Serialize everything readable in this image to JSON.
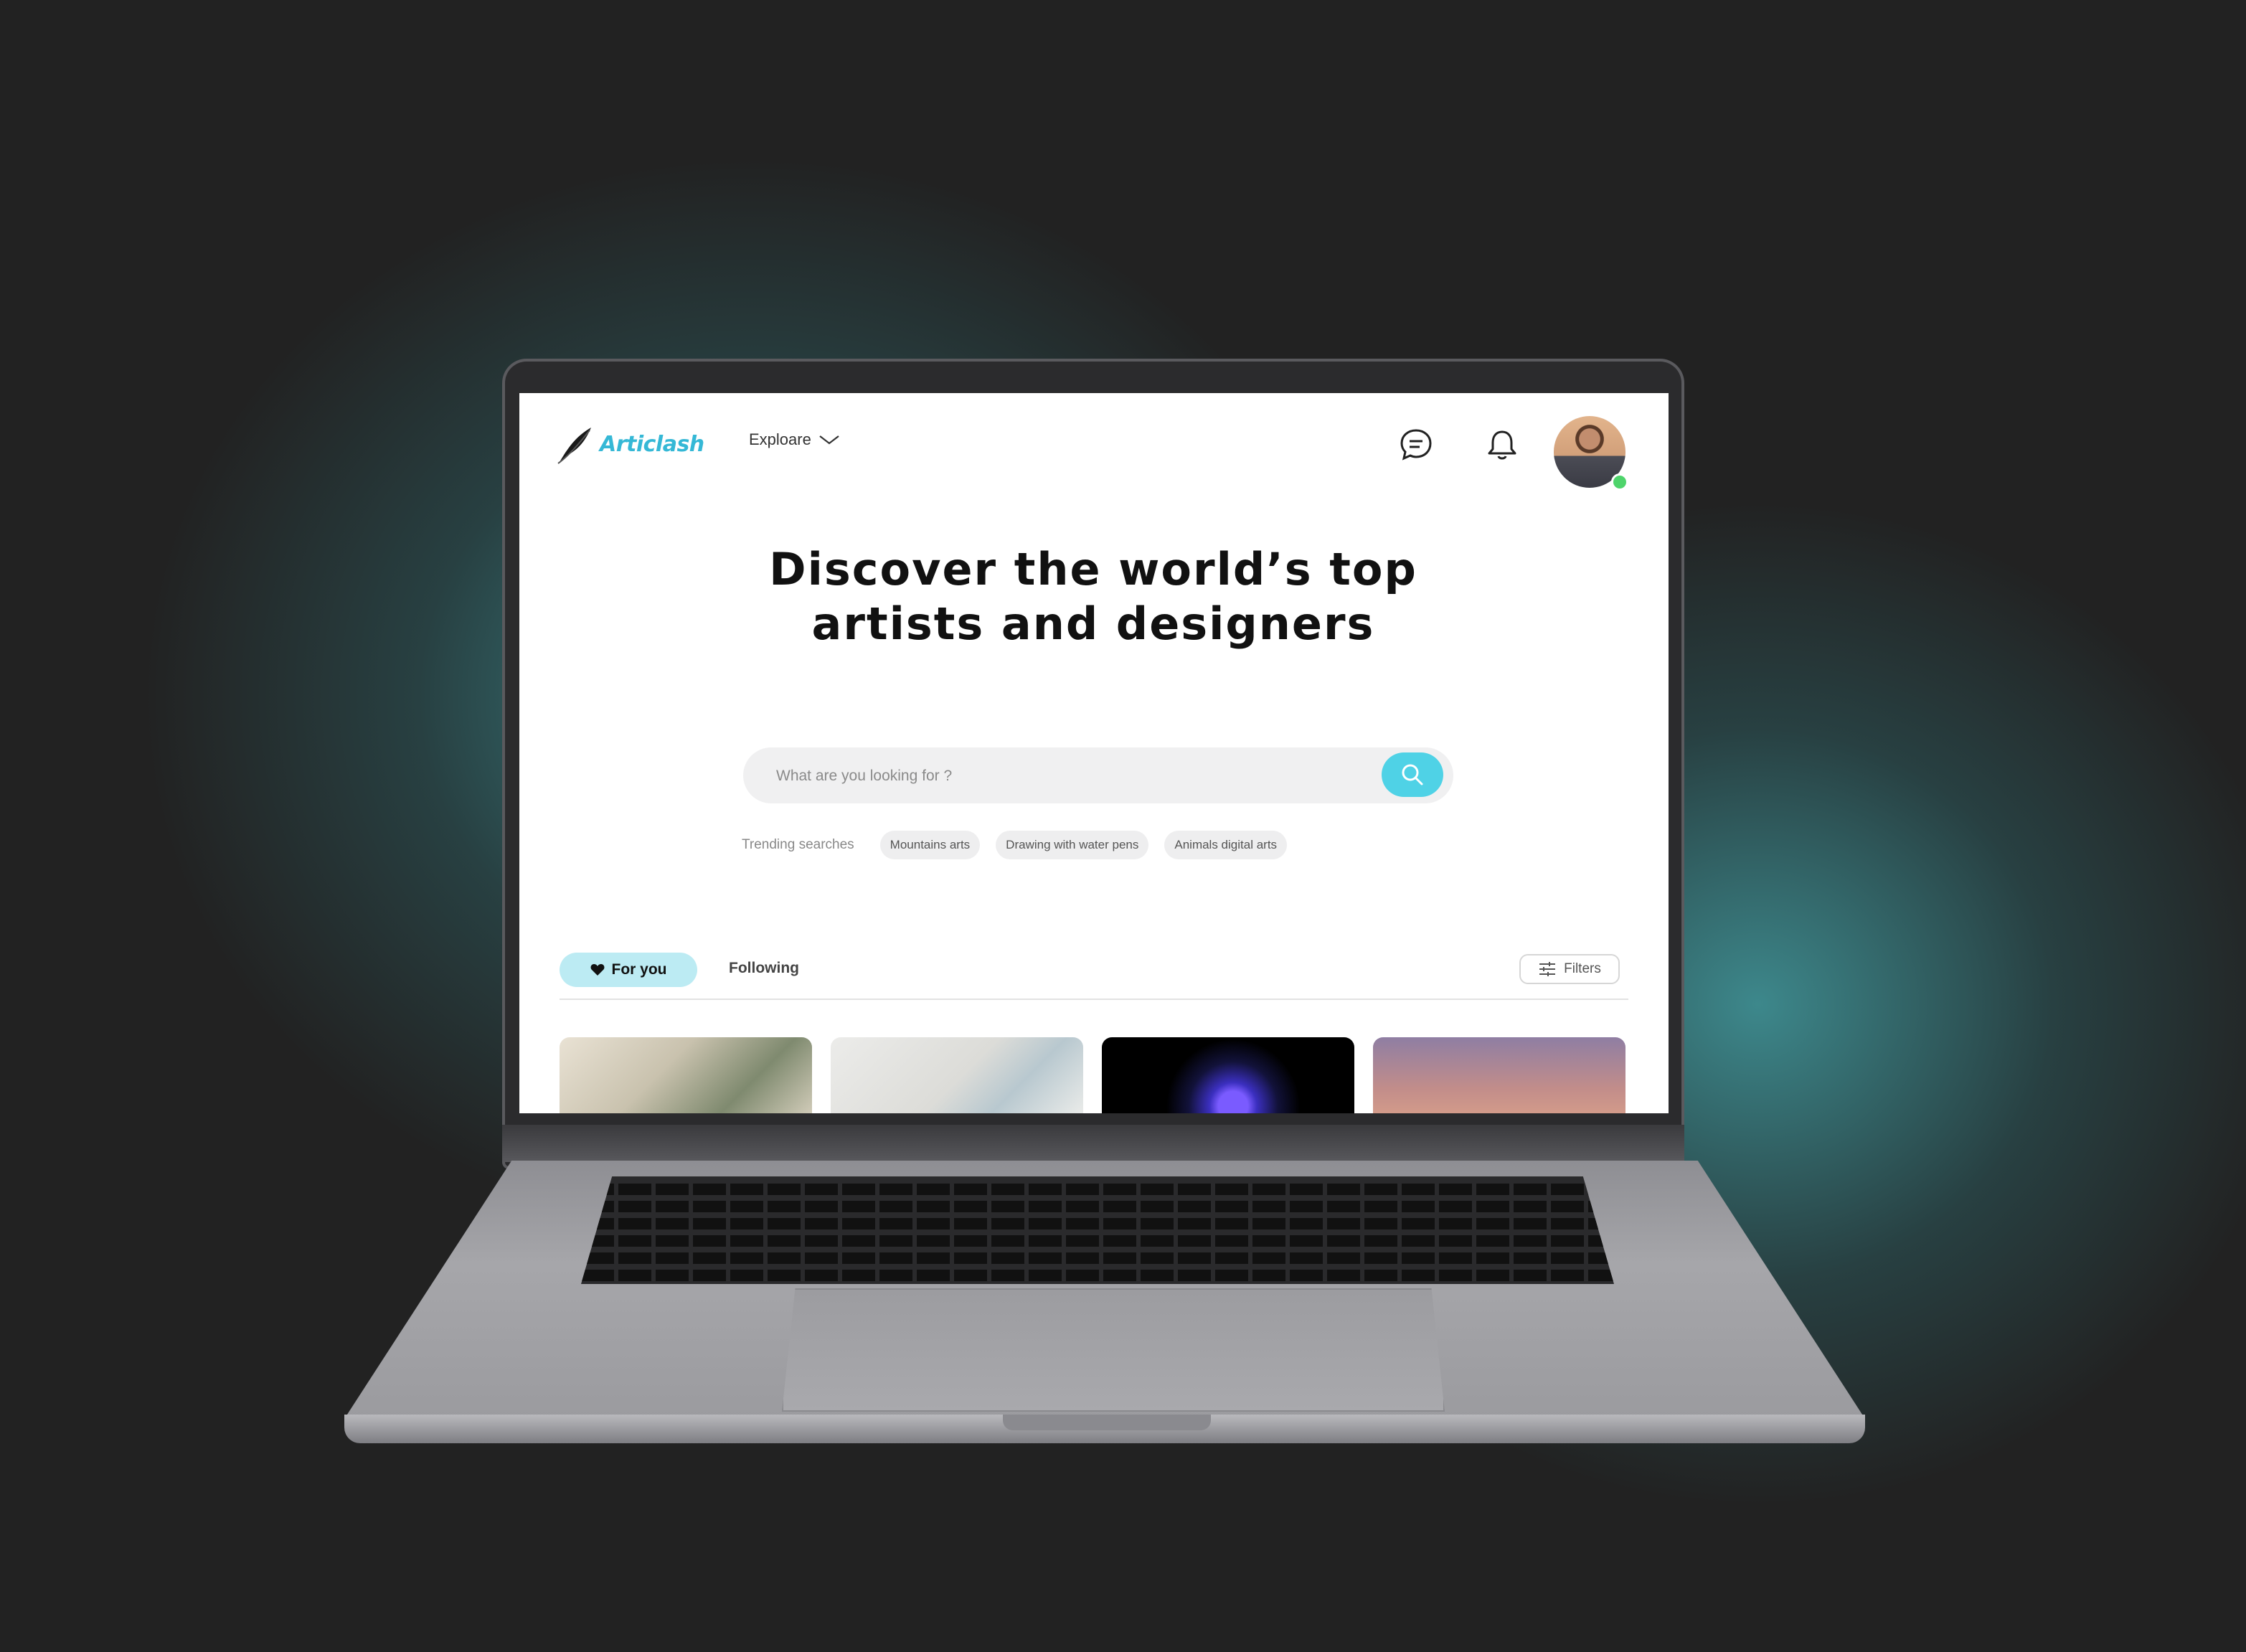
{
  "brand": {
    "name": "Articlash",
    "color": "#35b8d6"
  },
  "nav": {
    "explore_label": "Exploare"
  },
  "header_icons": [
    "chat-icon",
    "bell-icon"
  ],
  "hero": {
    "line1": "Discover the world’s top",
    "line2": "artists and designers"
  },
  "search": {
    "placeholder": "What are you looking for ?",
    "button_color": "#4fd2e6"
  },
  "trending": {
    "label": "Trending searches",
    "chips": [
      "Mountains arts",
      "Drawing with water pens",
      "Animals digital arts"
    ]
  },
  "feed_tabs": {
    "for_you": "For you",
    "following": "Following",
    "filters": "Filters"
  },
  "cards": [
    "heron-illustration",
    "ink-sketch",
    "neon-brain-art",
    "astronaut-sunset"
  ]
}
